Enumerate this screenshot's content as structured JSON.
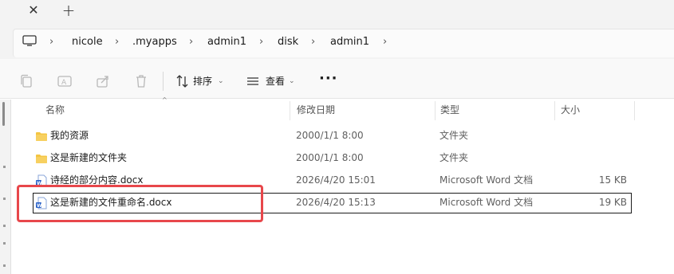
{
  "tabs": {
    "close_icon": "close-icon",
    "new_tab_icon": "plus-icon"
  },
  "address": {
    "root_icon": "computer-icon",
    "breadcrumbs": [
      "nicole",
      ".myapps",
      "admin1",
      "disk",
      "admin1"
    ]
  },
  "toolbar": {
    "sort_label": "排序",
    "view_label": "查看",
    "more_label": "···"
  },
  "columns": {
    "name": "名称",
    "date": "修改日期",
    "type": "类型",
    "size": "大小"
  },
  "files": [
    {
      "name": "我的资源",
      "date": "2000/1/1 8:00",
      "type": "文件夹",
      "size": "",
      "icon": "folder-icon"
    },
    {
      "name": "这是新建的文件夹",
      "date": "2000/1/1 8:00",
      "type": "文件夹",
      "size": "",
      "icon": "folder-icon"
    },
    {
      "name": "诗经的部分内容.docx",
      "date": "2026/4/20 15:01",
      "type": "Microsoft Word 文档",
      "size": "15 KB",
      "icon": "word-doc-icon"
    },
    {
      "name": "这是新建的文件重命名.docx",
      "date": "2026/4/20 15:13",
      "type": "Microsoft Word 文档",
      "size": "19 KB",
      "icon": "word-doc-icon"
    }
  ],
  "colors": {
    "highlight": "#e8474b",
    "folder": "#f4c542",
    "word_blue": "#2b63c9"
  }
}
